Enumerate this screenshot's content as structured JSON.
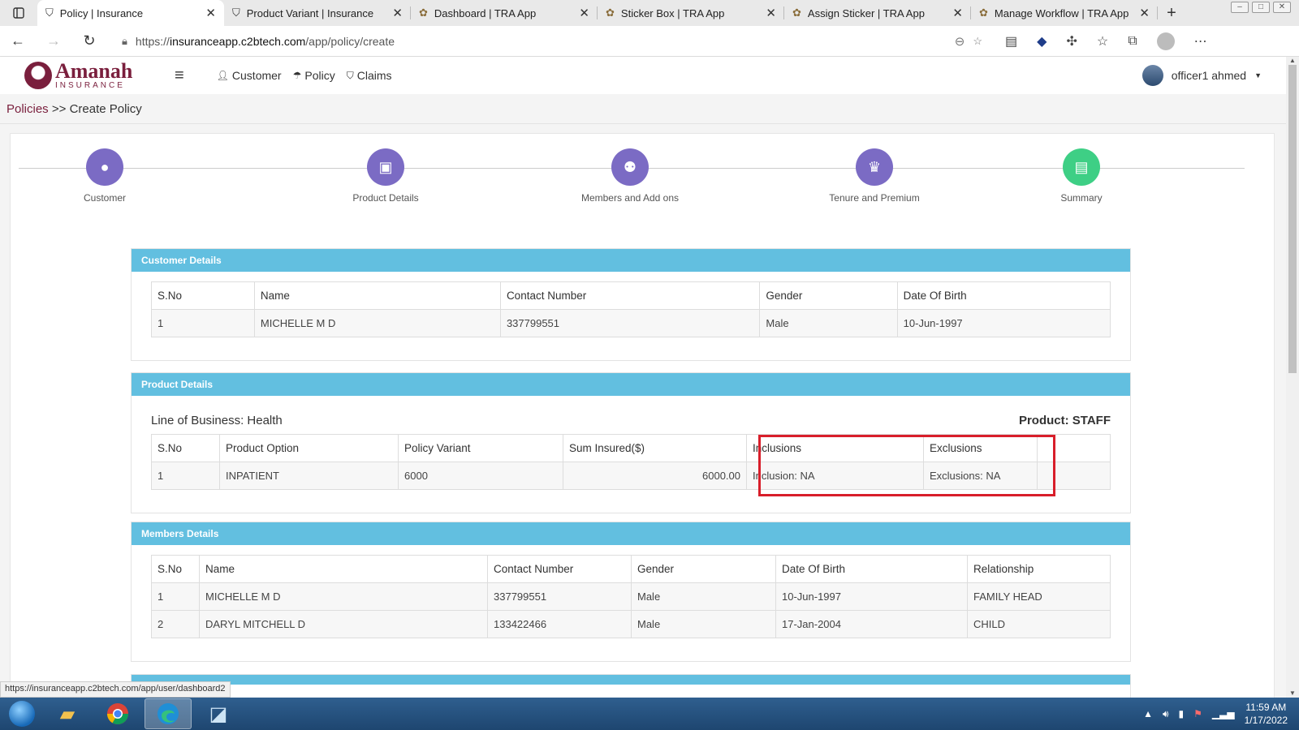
{
  "browser": {
    "tabs": [
      {
        "title": "Policy | Insurance",
        "active": true,
        "icon": "shield-icon"
      },
      {
        "title": "Product Variant | Insurance",
        "active": false,
        "icon": "shield-icon"
      },
      {
        "title": "Dashboard | TRA App",
        "active": false,
        "icon": "tra-emblem-icon"
      },
      {
        "title": "Sticker Box | TRA App",
        "active": false,
        "icon": "tra-emblem-icon"
      },
      {
        "title": "Assign Sticker | TRA App",
        "active": false,
        "icon": "tra-emblem-icon"
      },
      {
        "title": "Manage Workflow | TRA App",
        "active": false,
        "icon": "tra-emblem-icon"
      }
    ],
    "url_prefix": "https://",
    "url_host": "insuranceapp.c2btech.com",
    "url_path": "/app/policy/create",
    "status_url": "https://insuranceapp.c2btech.com/app/user/dashboard2"
  },
  "header": {
    "logo_main": "Amanah",
    "logo_sub": "INSURANCE",
    "nav": [
      {
        "label": "Customer",
        "icon": "user-icon"
      },
      {
        "label": "Policy",
        "icon": "umbrella-icon"
      },
      {
        "label": "Claims",
        "icon": "claims-icon"
      }
    ],
    "user_name": "officer1 ahmed"
  },
  "breadcrumb": {
    "root": "Policies",
    "separator": ">>",
    "current": "Create Policy"
  },
  "stepper": [
    {
      "label": "Customer",
      "icon": "person-icon",
      "color": "#7b6bc4"
    },
    {
      "label": "Product Details",
      "icon": "bag-icon",
      "color": "#7b6bc4"
    },
    {
      "label": "Members and Add ons",
      "icon": "members-icon",
      "color": "#7b6bc4"
    },
    {
      "label": "Tenure and Premium",
      "icon": "crown-icon",
      "color": "#7b6bc4"
    },
    {
      "label": "Summary",
      "icon": "document-icon",
      "color": "#3ecf85"
    }
  ],
  "customer_details": {
    "title": "Customer Details",
    "columns": [
      "S.No",
      "Name",
      "Contact Number",
      "Gender",
      "Date Of Birth"
    ],
    "rows": [
      [
        "1",
        "MICHELLE M D",
        "337799551",
        "Male",
        "10-Jun-1997"
      ]
    ]
  },
  "product_details": {
    "title": "Product Details",
    "line_of_business": "Line of Business: Health",
    "product": "Product: STAFF",
    "columns": [
      "S.No",
      "Product Option",
      "Policy Variant",
      "Sum Insured($)",
      "Inclusions",
      "Exclusions",
      ""
    ],
    "rows": [
      [
        "1",
        "INPATIENT",
        "6000",
        "6000.00",
        "Inclusion:   NA",
        "Exclusions:   NA",
        ""
      ]
    ]
  },
  "members_details": {
    "title": "Members Details",
    "columns": [
      "S.No",
      "Name",
      "Contact Number",
      "Gender",
      "Date Of Birth",
      "Relationship"
    ],
    "rows": [
      [
        "1",
        "MICHELLE M D",
        "337799551",
        "Male",
        "10-Jun-1997",
        "FAMILY HEAD"
      ],
      [
        "2",
        "DARYL MITCHELL D",
        "133422466",
        "Male",
        "17-Jan-2004",
        "CHILD"
      ]
    ]
  },
  "taskbar": {
    "time": "11:59 AM",
    "date": "1/17/2022"
  },
  "colors": {
    "panel_header": "#62bfe0",
    "brand": "#7a1f3d",
    "highlight": "#d81e2a"
  }
}
